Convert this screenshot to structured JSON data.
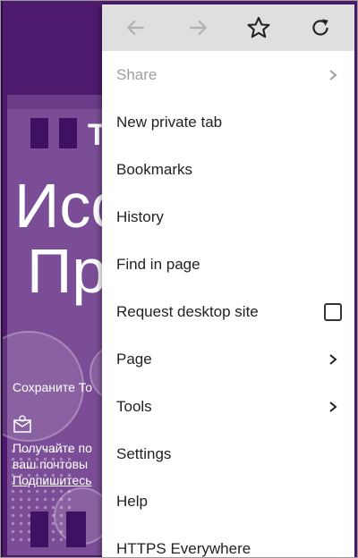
{
  "background_page": {
    "headline_line1": "Исс",
    "headline_line2": "Пр",
    "glyph": "T",
    "text_line1": "Сохраните То",
    "text_line2": "Получайте по",
    "text_line3": "ваш почтовы",
    "link_text": "Подпишитесь"
  },
  "toolbar": {
    "back_icon": "arrow-left-icon",
    "forward_icon": "arrow-right-icon",
    "bookmark_icon": "star-icon",
    "reload_icon": "reload-icon"
  },
  "menu": {
    "items": [
      {
        "label": "Share",
        "disabled": true,
        "trailing": "chevron-right-icon"
      },
      {
        "label": "New private tab"
      },
      {
        "label": "Bookmarks"
      },
      {
        "label": "History"
      },
      {
        "label": "Find in page"
      },
      {
        "label": "Request desktop site",
        "trailing": "checkbox",
        "checked": false
      },
      {
        "label": "Page",
        "trailing": "chevron-right-icon"
      },
      {
        "label": "Tools",
        "trailing": "chevron-right-icon"
      },
      {
        "label": "Settings"
      },
      {
        "label": "Help"
      },
      {
        "label": "HTTPS Everywhere"
      }
    ]
  },
  "colors": {
    "page_purple": "#4d1a6e",
    "panel_purple": "#7a4d96",
    "toolbar_gray": "#dfdfdf",
    "disabled_gray": "#9e9e9e"
  }
}
